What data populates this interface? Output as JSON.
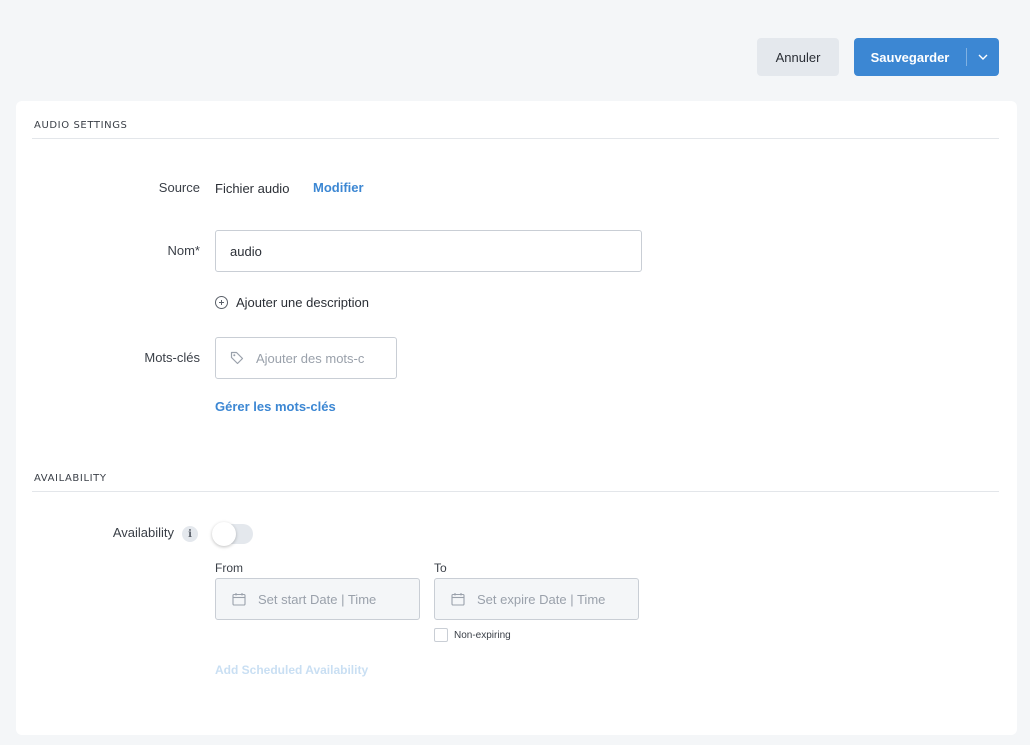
{
  "toolbar": {
    "cancel_label": "Annuler",
    "save_label": "Sauvegarder"
  },
  "audio_settings": {
    "section_title": "AUDIO SETTINGS",
    "source_label": "Source",
    "source_value": "Fichier audio",
    "modify_link": "Modifier",
    "name_label": "Nom*",
    "name_value": "audio",
    "add_description": "Ajouter une description",
    "keywords_label": "Mots-clés",
    "keywords_placeholder": "Ajouter des mots-c",
    "manage_keywords_link": "Gérer les mots-clés"
  },
  "availability": {
    "section_title": "AVAILABILITY",
    "availability_label": "Availability",
    "info_icon": "i",
    "toggle_on": false,
    "from_label": "From",
    "to_label": "To",
    "start_placeholder": "Set start Date | Time",
    "expire_placeholder": "Set expire Date | Time",
    "non_expiring_label": "Non-expiring",
    "add_scheduled_link": "Add Scheduled Availability"
  },
  "colors": {
    "accent": "#3c87d3",
    "background": "#f4f6f8",
    "card": "#ffffff"
  }
}
